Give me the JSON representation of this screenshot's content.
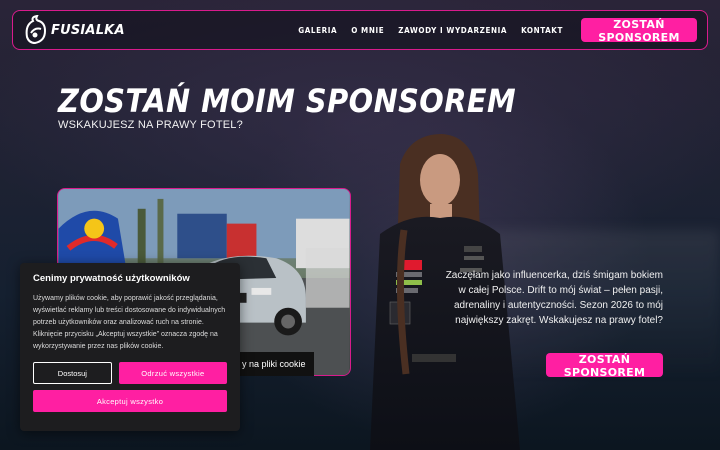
{
  "brand": {
    "name": "FUSIALKA"
  },
  "nav": {
    "items": [
      {
        "label": "GALERIA"
      },
      {
        "label": "O MNIE"
      },
      {
        "label": "ZAWODY I WYDARZENIA"
      },
      {
        "label": "KONTAKT"
      }
    ],
    "cta_label": "ZOSTAŃ SPONSOREM"
  },
  "hero": {
    "title": "ZOSTAŃ MOIM SPONSOREM",
    "subtitle": "WSKAKUJESZ NA PRAWY FOTEL?",
    "description": "Zaczęłam jako influencerka, dziś śmigam bokiem w całej Polsce. Drift to mój świat – pełen pasji, adrenaliny i autentyczności. Sezon 2026 to mój największy zakręt. Wskakujesz na prawy fotel?",
    "cta_label": "ZOSTAŃ SPONSOREM",
    "photo_caption": "y na pliki cookie"
  },
  "cookie_banner": {
    "title": "Cenimy prywatność użytkowników",
    "body": "Używamy plików cookie, aby poprawić jakość przeglądania, wyświetlać reklamy lub treści dostosowane do indywidualnych potrzeb użytkowników oraz analizować ruch na stronie. Kliknięcie przycisku „Akceptuj wszystkie” oznacza zgodę na wykorzystywanie przez nas plików cookie.",
    "customize_label": "Dostosuj",
    "reject_label": "Odrzuć wszystkie",
    "accept_label": "Akceptuj wszystko"
  },
  "colors": {
    "accent": "#ff1fa2",
    "background": "#152030"
  }
}
